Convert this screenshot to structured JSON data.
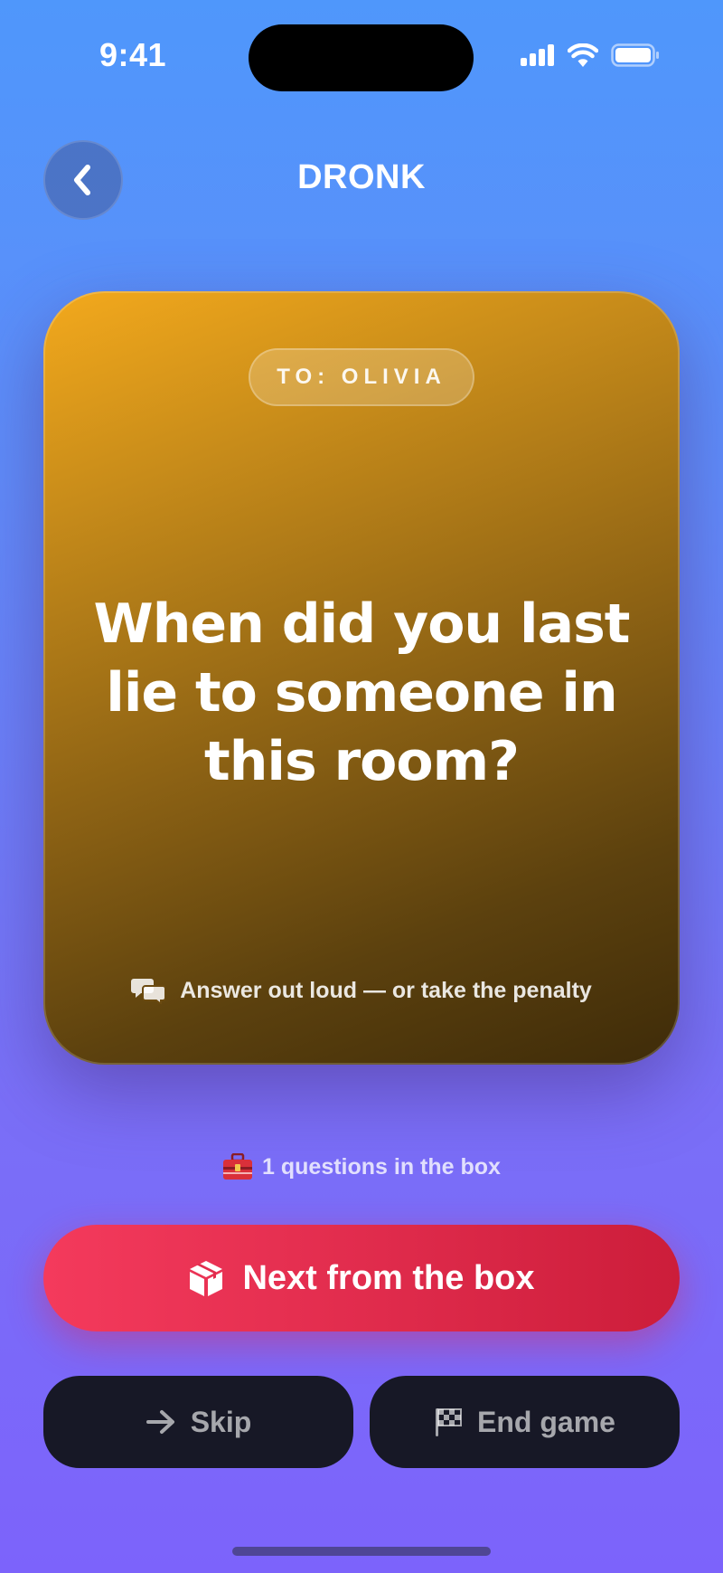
{
  "status_bar": {
    "time": "9:41"
  },
  "header": {
    "title": "DRONK",
    "back_icon": "chevron-left-icon"
  },
  "card": {
    "recipient": "TO: OLIVIA",
    "question": "When did you last lie to someone in this room?",
    "hint": "Answer out loud — or take the penalty",
    "hint_icon": "speech-bubbles-icon",
    "accent_color": "#f3a91c"
  },
  "box_count": {
    "icon": "toolbox-icon",
    "text": "1 questions in the box"
  },
  "actions": {
    "next_label": "Next from the box",
    "next_icon": "package-icon",
    "next_color": "#e12c4d",
    "skip_label": "Skip",
    "skip_icon": "arrow-right-icon",
    "end_label": "End game",
    "end_icon": "checkered-flag-icon"
  }
}
